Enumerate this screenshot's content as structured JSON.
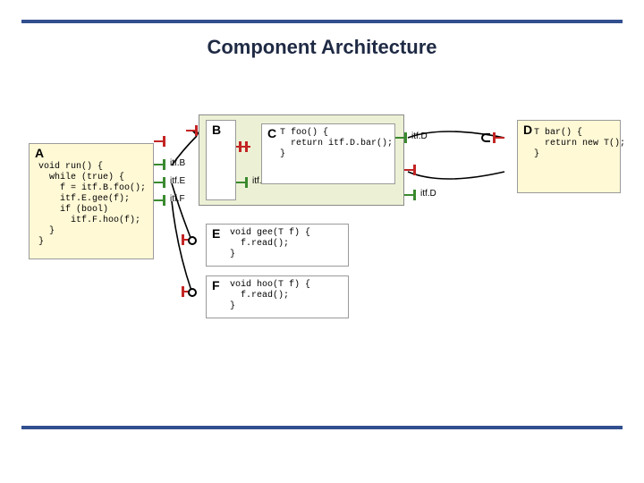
{
  "domain": "Diagram",
  "title": "Component Architecture",
  "components": {
    "A": {
      "name": "A",
      "code": "void run() {\n  while (true) {\n    f = itf.B.foo();\n    itf.E.gee(f);\n    if (bool)\n      itf.F.hoo(f);\n  }\n}",
      "ports": [
        {
          "label": "",
          "color": "red",
          "kind": "provided"
        },
        {
          "label": "itf.B",
          "color": "green",
          "kind": "required"
        },
        {
          "label": "itf.E",
          "color": "green",
          "kind": "required"
        },
        {
          "label": "itf.F",
          "color": "green",
          "kind": "required"
        }
      ]
    },
    "B": {
      "name": "B",
      "ports": [
        {
          "label": "",
          "color": "red",
          "kind": "provided"
        },
        {
          "label": "itf.B",
          "color": "green",
          "kind": "required"
        }
      ]
    },
    "C": {
      "name": "C",
      "code": "T foo() {\n  return itf.D.bar();\n}",
      "ports": [
        {
          "label": "",
          "color": "red",
          "kind": "provided"
        },
        {
          "label": "itf.D",
          "color": "green",
          "kind": "required"
        }
      ]
    },
    "D": {
      "name": "D",
      "code": "T bar() {\n  return new T();\n}",
      "ports": [
        {
          "label": "",
          "color": "red",
          "kind": "provided"
        },
        {
          "label": "itf.D",
          "color": "green",
          "kind": "required"
        }
      ]
    },
    "E": {
      "name": "E",
      "code": "void gee(T f) {\n  f.read();\n}"
    },
    "F": {
      "name": "F",
      "code": "void hoo(T f) {\n  f.read();\n}"
    }
  },
  "group_label": ""
}
